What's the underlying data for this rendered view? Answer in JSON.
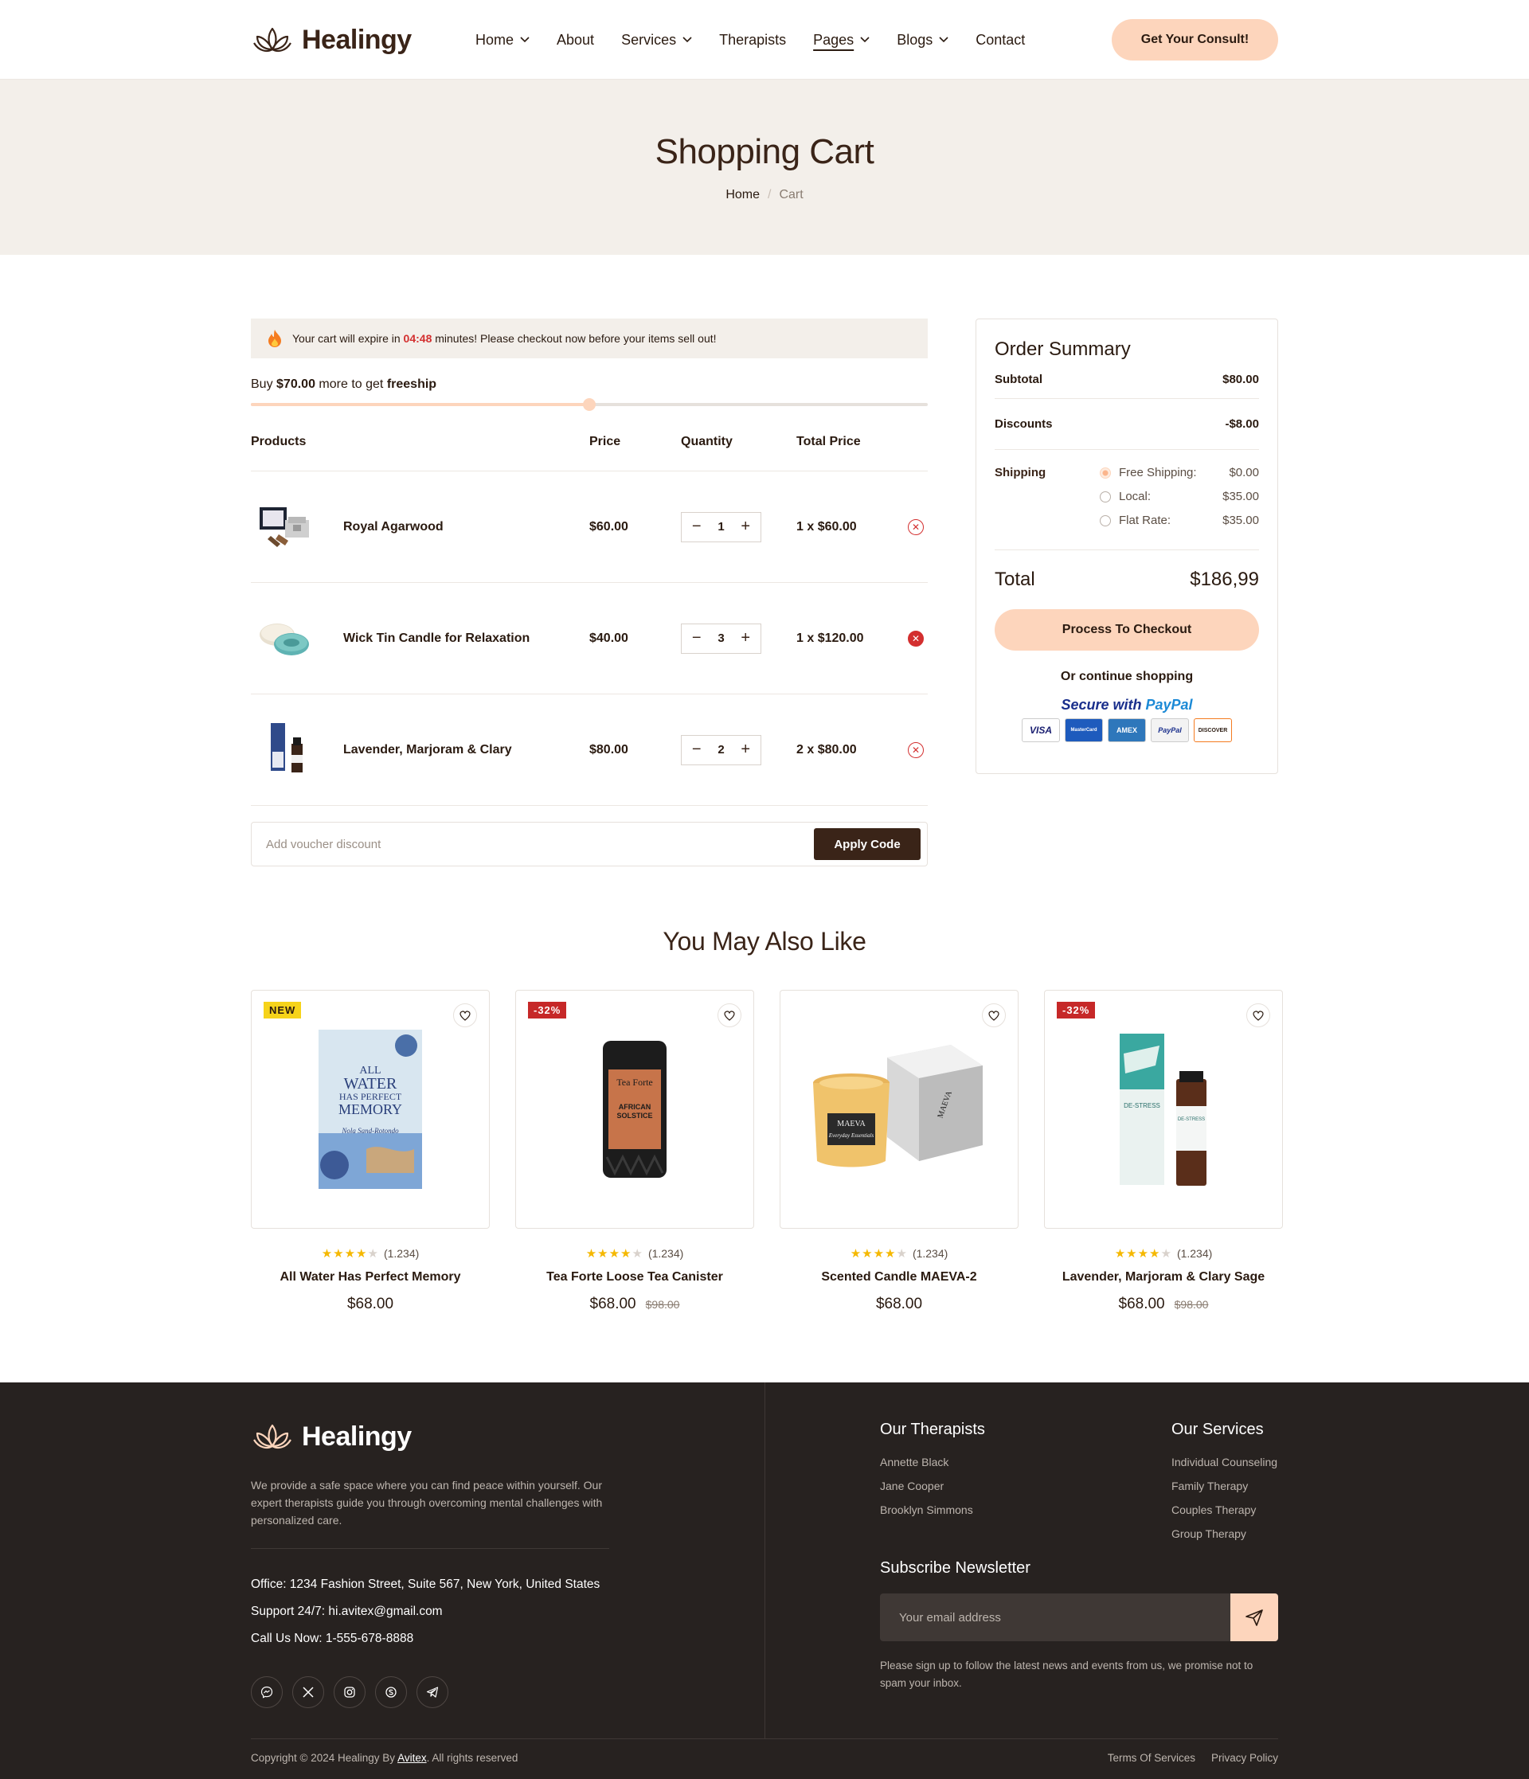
{
  "brand": {
    "name": "Healingy"
  },
  "nav": {
    "items": [
      {
        "label": "Home",
        "dropdown": true
      },
      {
        "label": "About",
        "dropdown": false
      },
      {
        "label": "Services",
        "dropdown": true
      },
      {
        "label": "Therapists",
        "dropdown": false
      },
      {
        "label": "Pages",
        "dropdown": true,
        "active": true
      },
      {
        "label": "Blogs",
        "dropdown": true
      },
      {
        "label": "Contact",
        "dropdown": false
      }
    ],
    "cta": "Get Your Consult!"
  },
  "hero": {
    "title": "Shopping Cart",
    "breadcrumb": {
      "home": "Home",
      "current": "Cart"
    }
  },
  "cart": {
    "expire": {
      "before": "Your cart will expire in",
      "time": "04:48",
      "after": "minutes! Please checkout now before your items sell out!"
    },
    "freeship": {
      "prefix": "Buy",
      "amount": "$70.00",
      "middle": "more to get",
      "word": "freeship",
      "progress": 0.5
    },
    "headers": {
      "products": "Products",
      "price": "Price",
      "quantity": "Quantity",
      "total": "Total Price"
    },
    "items": [
      {
        "name": "Royal Agarwood",
        "price": "$60.00",
        "qty": "1",
        "total": "1 x $60.00"
      },
      {
        "name": "Wick Tin Candle for Relaxation",
        "price": "$40.00",
        "qty": "3",
        "total": "1 x $120.00"
      },
      {
        "name": "Lavender, Marjoram & Clary",
        "price": "$80.00",
        "qty": "2",
        "total": "2 x $80.00"
      }
    ],
    "voucher": {
      "placeholder": "Add voucher discount",
      "button": "Apply Code"
    }
  },
  "summary": {
    "title": "Order Summary",
    "subtotal_label": "Subtotal",
    "subtotal": "$80.00",
    "discount_label": "Discounts",
    "discount": "-$8.00",
    "shipping_label": "Shipping",
    "shipping_options": [
      {
        "label": "Free Shipping:",
        "price": "$0.00",
        "selected": true
      },
      {
        "label": "Local:",
        "price": "$35.00",
        "selected": false
      },
      {
        "label": "Flat Rate:",
        "price": "$35.00",
        "selected": false
      }
    ],
    "total_label": "Total",
    "total": "$186,99",
    "checkout": "Process To Checkout",
    "continue": "Or continue shopping",
    "secure": "Secure with",
    "paypal": "PayPal",
    "cards": [
      "VISA",
      "MasterCard",
      "AMEX",
      "PayPal",
      "DISCOVER"
    ]
  },
  "recs": {
    "title": "You May Also Like",
    "products": [
      {
        "badge": "NEW",
        "name": "All Water Has Perfect Memory",
        "rating": 4,
        "reviews": "(1.234)",
        "price": "$68.00",
        "old_price": ""
      },
      {
        "badge": "-32%",
        "name": "Tea Forte Loose Tea Canister",
        "rating": 4,
        "reviews": "(1.234)",
        "price": "$68.00",
        "old_price": "$98.00"
      },
      {
        "badge": "",
        "name": "Scented Candle MAEVA-2",
        "rating": 4,
        "reviews": "(1.234)",
        "price": "$68.00",
        "old_price": ""
      },
      {
        "badge": "-32%",
        "name": "Lavender, Marjoram & Clary Sage",
        "rating": 4,
        "reviews": "(1.234)",
        "price": "$68.00",
        "old_price": "$98.00"
      }
    ],
    "image_text": {
      "book_line1": "ALL",
      "book_line2": "WATER",
      "book_line3": "HAS PERFECT",
      "book_line4": "MEMORY",
      "book_author": "Nola Sand-Rotondo",
      "tea_brand": "Tea Forte",
      "tea_name1": "AFRICAN",
      "tea_name2": "SOLSTICE",
      "candle_brand": "MAEVA",
      "candle_sub": "Everyday Essentials",
      "oil_label": "DE-STRESS"
    }
  },
  "footer": {
    "description": "We provide a safe space where you can find peace within yourself. Our expert therapists guide you through overcoming mental challenges with personalized care.",
    "office": "Office: 1234 Fashion Street, Suite 567, New York, United States",
    "support": "Support 24/7: hi.avitex@gmail.com",
    "call": "Call Us Now: 1-555-678-8888",
    "therapists_title": "Our Therapists",
    "therapists": [
      "Annette Black",
      "Jane Cooper",
      "Brooklyn Simmons"
    ],
    "services_title": "Our Services",
    "services": [
      "Individual Counseling",
      "Family Therapy",
      "Couples Therapy",
      "Group Therapy"
    ],
    "newsletter_title": "Subscribe Newsletter",
    "newsletter_placeholder": "Your email address",
    "newsletter_note": "Please sign up to follow the latest news and events from us, we promise not to spam your inbox.",
    "copyright_prefix": "Copyright © 2024 Healingy By",
    "copyright_link": "Avitex",
    "copyright_suffix": ". All rights reserved",
    "terms": "Terms Of Services",
    "privacy": "Privacy Policy"
  },
  "colors": {
    "accent": "#fdd5bc",
    "brand_dark": "#3a2418",
    "alert_red": "#d32f2f",
    "footer_bg": "#272220",
    "hero_bg": "#f3efea"
  }
}
